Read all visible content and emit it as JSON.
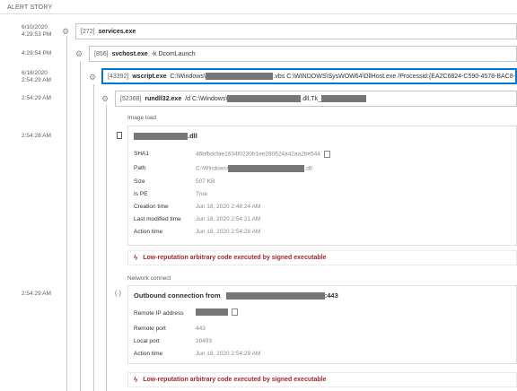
{
  "header": {
    "title": "ALERT STORY"
  },
  "timestamps": {
    "t1": "6/10/2020\n4:29:53 PM",
    "t2": "4:29:54 PM",
    "t3": "6/18/2020\n2:54:29 AM",
    "t4": "2:54:29 AM",
    "t5": "2:54:28 AM",
    "t6": "2:54:29 AM"
  },
  "processes": [
    {
      "pid": "[272]",
      "name": "services.exe",
      "cmd": ""
    },
    {
      "pid": "[856]",
      "name": "svchost.exe",
      "cmd": "-k DcomLaunch"
    },
    {
      "pid": "[43392]",
      "name": "wscript.exe",
      "cmd_a": "C:\\Windows\\",
      "cmd_b": ".vbs C:\\WINDOWS\\SysWOW64\\DllHost.exe /Processid:{EA2C6824-C590-4578-BAC8-"
    },
    {
      "pid": "[52368]",
      "name": "rundll32.exe",
      "cmd_a": "/d C:\\Windows\\",
      "cmd_b": ".dll,Tk_"
    }
  ],
  "image_load": {
    "section_label": "Image load",
    "file_suffix": ".dll",
    "rows": [
      {
        "label": "SHA1",
        "value": "46bfbdcfae1634f0230b1ee280624a42aa2be544"
      },
      {
        "label": "Path",
        "value_a": "C:\\Windows\\",
        "value_b": ".dll"
      },
      {
        "label": "Size",
        "value": "507 KB"
      },
      {
        "label": "Is PE",
        "value": "True"
      },
      {
        "label": "Creation time",
        "value": "Jun 18, 2020 2:48:24 AM"
      },
      {
        "label": "Last modified time",
        "value": "Jun 18, 2020 2:54:21 AM"
      },
      {
        "label": "Action time",
        "value": "Jun 18, 2020 2:54:28 AM"
      }
    ],
    "alert": "Low-reputation arbitrary code executed by signed executable"
  },
  "network": {
    "section_label": "Network connect",
    "title_a": "Outbound connection from",
    "title_b": ":443",
    "rows": [
      {
        "label": "Remote IP address",
        "value": ""
      },
      {
        "label": "Remote port",
        "value": "443"
      },
      {
        "label": "Local port",
        "value": "20493"
      },
      {
        "label": "Action time",
        "value": "Jun 18, 2020 2:54:29 AM"
      }
    ],
    "alert": "Low-reputation arbitrary code executed by signed executable"
  },
  "icons": {
    "process": "gear-icon",
    "file": "file-icon",
    "network": "network-icon",
    "alert": "bolt-icon",
    "copy": "copy-icon"
  },
  "colors": {
    "accent": "#0078d4",
    "alert": "#a4262c",
    "redaction": "#777777"
  }
}
